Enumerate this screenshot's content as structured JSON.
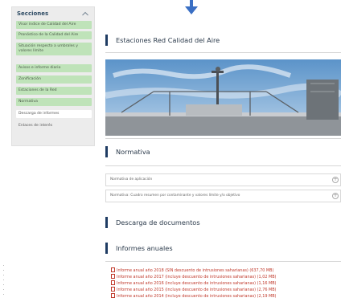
{
  "sidebar": {
    "title": "Secciones",
    "items": [
      {
        "label": "Visor índice de Calidad del Aire",
        "style": "green"
      },
      {
        "label": "Pronóstico de la Calidad del Aire",
        "style": "green"
      },
      {
        "label": "Situación respecto a umbrales y valores límite",
        "style": "green"
      },
      {
        "label": "Avisos e informe diario",
        "style": "green"
      },
      {
        "label": "Zonificación",
        "style": "green"
      },
      {
        "label": "Estaciones de la Red",
        "style": "green"
      },
      {
        "label": "Normativa",
        "style": "green"
      },
      {
        "label": "Descarga de informes",
        "style": "white"
      },
      {
        "label": "Enlaces de interés",
        "style": "plain"
      }
    ]
  },
  "main": {
    "stations_heading": "Estaciones Red Calidad del Aire",
    "normativa_heading": "Normativa",
    "accordions": [
      {
        "label": "Normativa de aplicación"
      },
      {
        "label": "Normativa: Cuadro resumen por contaminante y valores límite y/o objetivo"
      }
    ],
    "downloads_heading": "Descarga de documentos",
    "annual_heading": "Informes anuales",
    "reports": [
      "Informe anual año 2018 (SIN descuento de intrusiones saharianas) (637,70 MB)",
      "Informe anual año 2017 (incluye descuento de intrusiones saharianas) (1,02 MB)",
      "Informe anual año 2016 (incluye descuento de intrusiones saharianas) (1,16 MB)",
      "Informe anual año 2015 (incluye descuento de intrusiones saharianas) (2,76 MB)",
      "Informe anual año 2014 (incluye descuento de intrusiones saharianas) (2,19 MB)"
    ]
  },
  "colors": {
    "sidebar_item_green": "#bfe3b9",
    "heading_bar": "#1f3c63",
    "report_link": "#c0392b",
    "arrow": "#3a6fc4"
  },
  "icons": {
    "scroll_indicator": "down-arrow-icon",
    "sidebar_collapse": "chevron-up-icon",
    "accordion_expand": "plus-circle-icon",
    "report_file": "document-icon"
  }
}
